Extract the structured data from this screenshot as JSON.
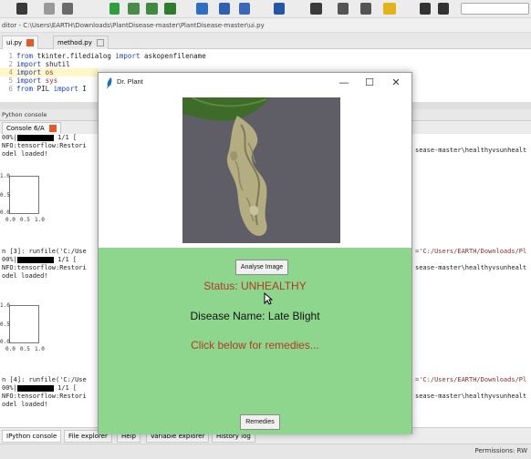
{
  "ide": {
    "window_title": "ditor - C:\\Users\\EARTH\\Downloads\\PlantDisease-master\\PlantDisease-master\\ui.py",
    "editor_tabs": [
      {
        "label": "ui.py"
      },
      {
        "label": "method.py"
      }
    ],
    "code_lines": [
      {
        "num": "1",
        "text": "from tkinter.filedialog import askopenfilename"
      },
      {
        "num": "2",
        "text": "import shutil"
      },
      {
        "num": "4",
        "text": "import os"
      },
      {
        "num": "5",
        "text": "import sys"
      },
      {
        "num": "6",
        "text": "from PIL import I"
      }
    ],
    "console_pane_title": "Python console",
    "console_tab": "Console 6/A",
    "console_lines": {
      "a1": "00%|",
      "a1b": "1/1 [",
      "a2": "NFO:tensorflow:Restori",
      "a3": "odel loaded!",
      "b1": "n [3]: runfile('C:/Use",
      "b2": "00%|",
      "b2b": "1/1 [",
      "b3": "NFO:tensorflow:Restori",
      "b4": "odel loaded!",
      "c1": "n [4]: runfile('C:/Use",
      "c2": "00%|",
      "c2b": "1/1 [",
      "c3": "NFO:tensorflow:Restori",
      "c4": "odel loaded!"
    },
    "console_right": {
      "r1": "sease-master\\healthyvsunhealt",
      "r2": "='C:/Users/EARTH/Downloads/Pl",
      "r3": "sease-master\\healthyvsunhealt",
      "r4": "='C:/Users/EARTH/Downloads/Pl",
      "r5": "sease-master\\healthyvsunhealt"
    },
    "plot_ticks": {
      "y1": "1.0",
      "y2": "0.5",
      "y3": "0.0",
      "x1": "0.0",
      "x2": "0.5",
      "x3": "1.0"
    },
    "bottom_tabs": [
      {
        "label": "IPython console"
      },
      {
        "label": "File explorer"
      },
      {
        "label": "Help"
      },
      {
        "label": "Variable explorer"
      },
      {
        "label": "History log"
      }
    ],
    "permissions": "Permissions: RW"
  },
  "app": {
    "title": "Dr. Plant",
    "minimize": "—",
    "maximize": "☐",
    "close": "✕",
    "analyse_button": "Analyse Image",
    "status_text": "Status: UNHEALTHY",
    "disease_text": "Disease Name: Late Blight",
    "remedy_prompt": "Click below for remedies...",
    "remedies_button": "Remedies"
  },
  "colors": {
    "app_background": "#8ed68e",
    "status_red": "#b13a24",
    "image_background": "#5f5e66"
  }
}
